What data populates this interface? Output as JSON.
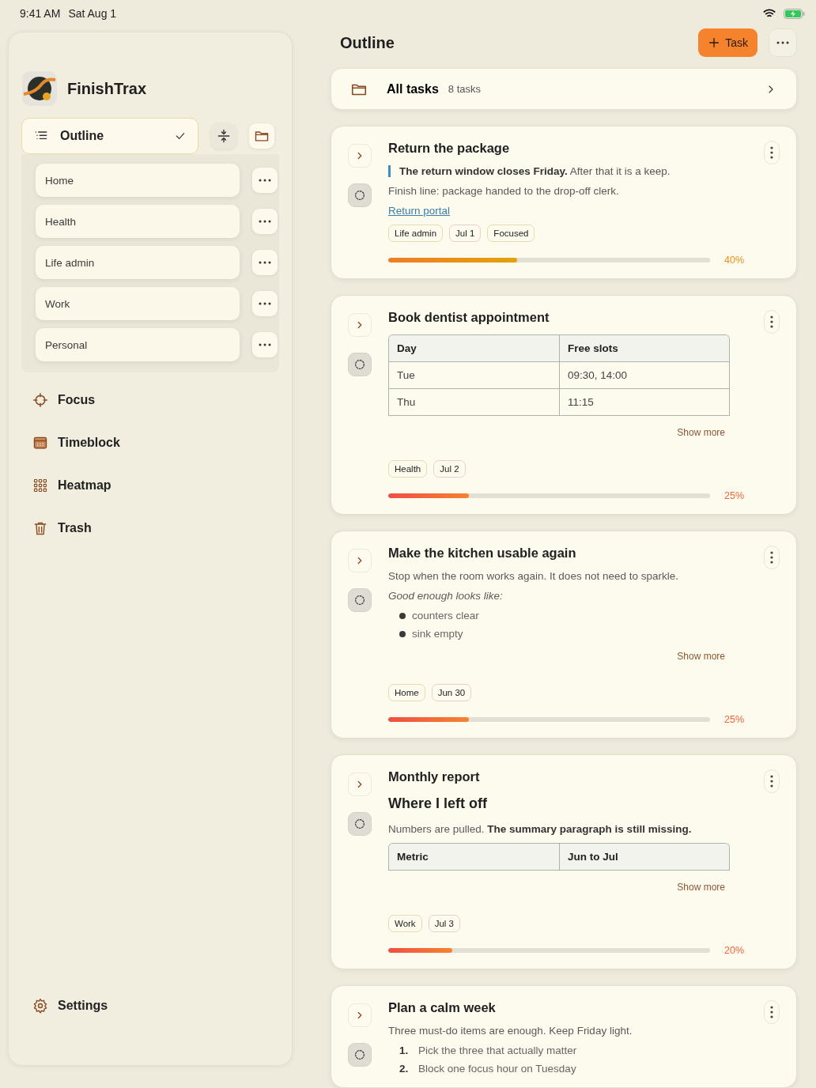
{
  "status_bar": {
    "time": "9:41 AM",
    "date": "Sat Aug 1"
  },
  "sidebar": {
    "app_name": "FinishTrax",
    "view_picker": {
      "label": "Outline",
      "checked": true
    },
    "lists": [
      {
        "label": "Home"
      },
      {
        "label": "Health"
      },
      {
        "label": "Life admin"
      },
      {
        "label": "Work"
      },
      {
        "label": "Personal"
      }
    ],
    "nav": [
      {
        "label": "Focus",
        "kind": "focus"
      },
      {
        "label": "Timeblock",
        "kind": "calendar"
      },
      {
        "label": "Heatmap",
        "kind": "grid"
      },
      {
        "label": "Trash",
        "kind": "trash"
      }
    ],
    "footer": {
      "label": "Settings"
    }
  },
  "header": {
    "title": "Outline",
    "add_button": "Task"
  },
  "all_tasks": {
    "label": "All tasks",
    "count": "8 tasks"
  },
  "tasks": [
    {
      "title": "Return the package",
      "blocks": [
        {
          "kind": "callout",
          "text": "**The return window closes Friday.** After that it is a keep."
        },
        {
          "kind": "text",
          "text": "Finish line: package handed to the drop-off clerk."
        },
        {
          "kind": "link",
          "text": "Return portal"
        }
      ],
      "tags": [
        {
          "label": "Life admin",
          "kind": "category"
        },
        {
          "label": "Jul 1",
          "kind": "date"
        },
        {
          "label": "Focused",
          "kind": "category"
        }
      ],
      "progress": {
        "level": 0.4,
        "reading": "40%"
      }
    },
    {
      "title": "Book dentist appointment",
      "blocks": [
        {
          "kind": "table",
          "columns": [
            "Day",
            "Free slots"
          ],
          "rows": [
            [
              "Tue",
              "09:30, 14:00"
            ],
            [
              "Thu",
              "11:15"
            ]
          ]
        },
        {
          "kind": "show_more",
          "text": "Show more"
        }
      ],
      "tags": [
        {
          "label": "Health",
          "kind": "category"
        },
        {
          "label": "Jul 2",
          "kind": "date"
        }
      ],
      "progress": {
        "level": 0.25,
        "reading": "25%"
      }
    },
    {
      "title": "Make the kitchen usable again",
      "blocks": [
        {
          "kind": "text",
          "text": "Stop when the room works again. It does not need to sparkle."
        },
        {
          "kind": "note",
          "text": "Good enough looks like:"
        },
        {
          "kind": "bullets",
          "items": [
            "counters clear",
            "sink empty"
          ]
        },
        {
          "kind": "show_more",
          "text": "Show more"
        }
      ],
      "tags": [
        {
          "label": "Home",
          "kind": "category"
        },
        {
          "label": "Jun 30",
          "kind": "date"
        }
      ],
      "progress": {
        "level": 0.25,
        "reading": "25%"
      }
    },
    {
      "title": "Monthly report",
      "blocks": [
        {
          "kind": "heading",
          "text": "Where I left off"
        },
        {
          "kind": "text",
          "text": "Numbers are pulled. **The summary paragraph is still missing.**"
        },
        {
          "kind": "table",
          "columns": [
            "Metric",
            "Jun to Jul"
          ]
        },
        {
          "kind": "show_more",
          "text": "Show more"
        }
      ],
      "tags": [
        {
          "label": "Work",
          "kind": "category"
        },
        {
          "label": "Jul 3",
          "kind": "date"
        }
      ],
      "progress": {
        "level": 0.2,
        "reading": "20%"
      }
    },
    {
      "title": "Plan a calm week",
      "blocks": [
        {
          "kind": "text",
          "text": "Three must-do items are enough. Keep Friday light."
        },
        {
          "kind": "numbered",
          "items": [
            {
              "marker": "1.",
              "text": "Pick the three that actually matter"
            },
            {
              "marker": "2.",
              "text": "Block one focus hour on Tuesday"
            }
          ]
        }
      ]
    }
  ]
}
